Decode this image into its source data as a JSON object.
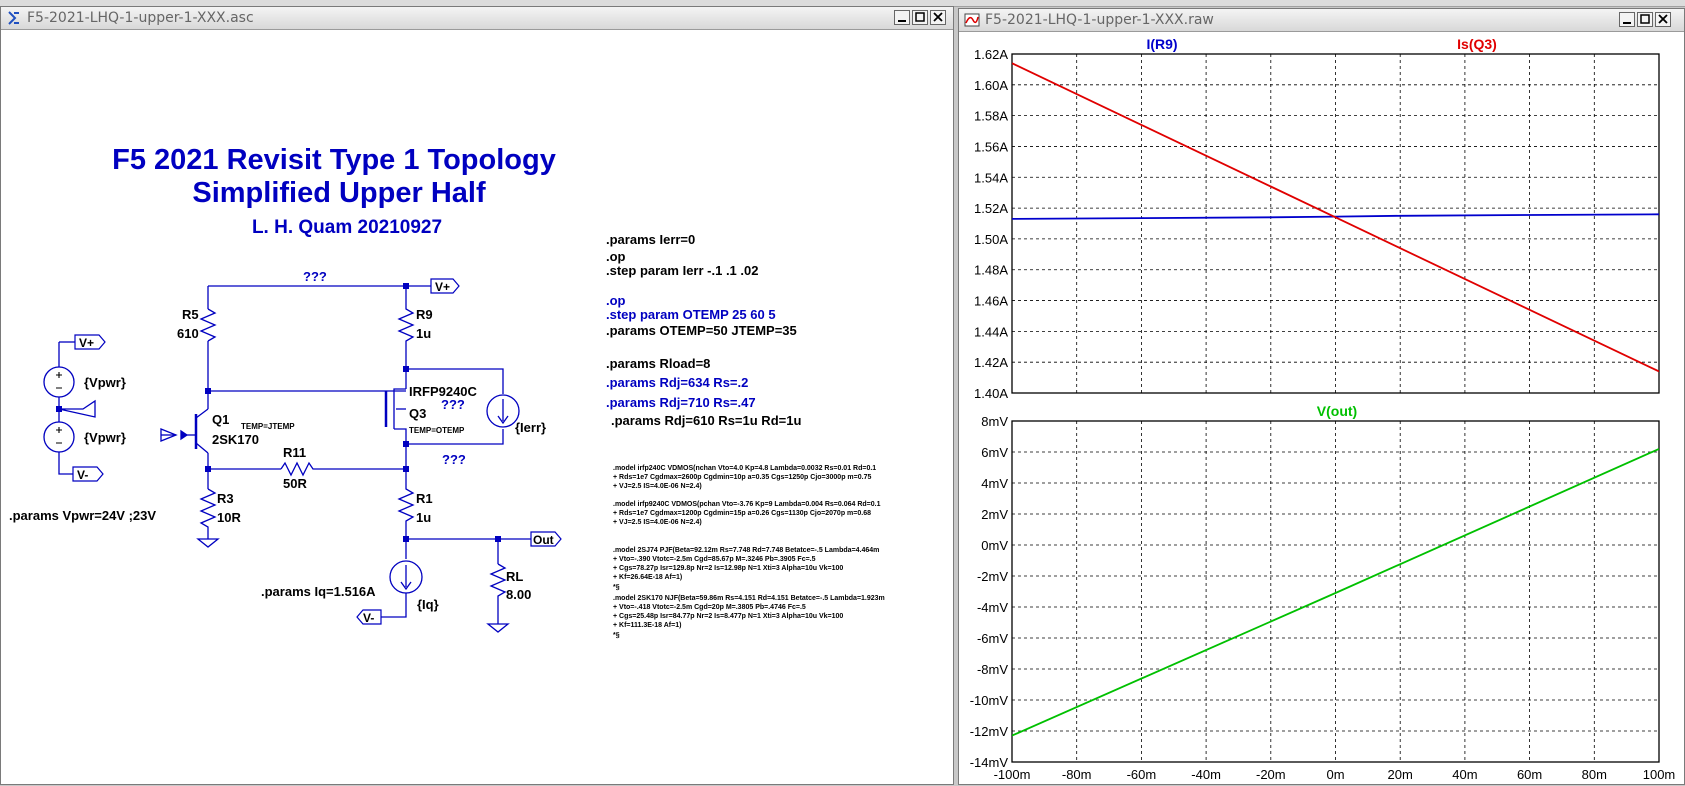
{
  "schematic_window": {
    "title": "F5-2021-LHQ-1-upper-1-XXX.asc",
    "heading": {
      "line1": "F5 2021 Revisit Type 1 Topology",
      "line2": "Simplified Upper Half",
      "author": "L. H. Quam  20210927"
    },
    "components": {
      "r5_name": "R5",
      "r5_value": "610",
      "r9_name": "R9",
      "r9_value": "1u",
      "r11_name": "R11",
      "r11_value": "50R",
      "r3_name": "R3",
      "r3_value": "10R",
      "r1_name": "R1",
      "r1_value": "1u",
      "rl_name": "RL",
      "rl_value": "8.00",
      "q1_name": "Q1",
      "q1_model": "2SK170",
      "q1_temp": "TEMP=JTEMP",
      "q3_name": "Q3",
      "q3_model": "IRFP9240C",
      "q3_temp": "TEMP=OTEMP",
      "vsrc_top": "{Vpwr}",
      "vsrc_bottom": "{Vpwr}",
      "isrc_ierr": "{Ierr}",
      "isrc_iq": "{Iq}",
      "unknown_1": "???",
      "unknown_2": "???",
      "unknown_3": "???",
      "vplus_label": "V+",
      "vplus_label_2": "V+",
      "vminus_label": "V-",
      "vminus_label_2": "V-",
      "out_label": "Out"
    },
    "params_vpwr": ".params Vpwr=24V ;23V",
    "params_iq": ".params Iq=1.516A",
    "directives": [
      {
        "text": ".params Ierr=0",
        "color": "#000000"
      },
      {
        "text": ".op",
        "color": "#000000"
      },
      {
        "text": ".step param Ierr -.1 .1 .02",
        "color": "#000000"
      },
      {
        "text": ".op",
        "color": "#0000c0"
      },
      {
        "text": ".step param OTEMP 25 60 5",
        "color": "#0000c0"
      },
      {
        "text": ".params OTEMP=50 JTEMP=35",
        "color": "#000000"
      },
      {
        "text": ".params Rload=8",
        "color": "#000000"
      },
      {
        "text": ".params Rdj=634 Rs=.2",
        "color": "#0000c0"
      },
      {
        "text": ".params Rdj=710 Rs=.47",
        "color": "#0000c0"
      },
      {
        "text": ".params Rdj=610 Rs=1u Rd=1u",
        "color": "#000000"
      }
    ],
    "models": [
      ".model irfp240C VDMOS(nchan Vto=4.0 Kp=4.8 Lambda=0.0032 Rs=0.01 Rd=0.1",
      "+ Rds=1e7 Cgdmax=2600p Cgdmin=10p a=0.35 Cgs=1250p Cjo=3000p m=0.75",
      "+ VJ=2.5 IS=4.0E-06 N=2.4)",
      ".model irfp9240C VDMOS(pchan Vto=-3.76 Kp=9 Lambda=0.004 Rs=0.064 Rd=0.1",
      "+ Rds=1e7 Cgdmax=1200p Cgdmin=15p a=0.26 Cgs=1130p Cjo=2070p m=0.68",
      "+ VJ=2.5 IS=4.0E-06 N=2.4)",
      ".model 2SJ74   PJF(Beta=92.12m Rs=7.748 Rd=7.748 Betatce=-.5 Lambda=4.464m",
      "+            Vto=-.390 Vtotc=-2.5m Cgd=85.67p M=.3246 Pb=.3905 Fc=.5",
      "+            Cgs=78.27p Isr=129.8p Nr=2 Is=12.98p N=1 Xti=3 Alpha=10u Vk=100",
      "+            Kf=26.64E-18 Af=1)",
      "*§",
      ".model 2SK170  NJF(Beta=59.86m Rs=4.151 Rd=4.151 Betatce=-.5 Lambda=1.923m",
      "+            Vto=-.418 Vtotc=-2.5m Cgd=20p M=.3805 Pb=.4746 Fc=.5",
      "+            Cgs=25.48p Isr=84.77p Nr=2 Is=8.477p N=1 Xti=3 Alpha=10u Vk=100",
      "+            Kf=111.3E-18 Af=1)",
      "*§"
    ]
  },
  "waveform_window": {
    "title": "F5-2021-LHQ-1-upper-1-XXX.raw",
    "chart_data": [
      {
        "type": "line",
        "series": [
          {
            "name": "I(R9)",
            "color": "#0000cc",
            "x": [
              -0.1,
              -0.06,
              -0.02,
              0,
              0.02,
              0.06,
              0.1
            ],
            "y": [
              1.513,
              1.5135,
              1.514,
              1.5145,
              1.515,
              1.5155,
              1.516
            ]
          },
          {
            "name": "Is(Q3)",
            "color": "#e00000",
            "x": [
              -0.1,
              -0.06,
              -0.02,
              0,
              0.02,
              0.06,
              0.1
            ],
            "y": [
              1.614,
              1.574,
              1.534,
              1.514,
              1.494,
              1.454,
              1.414
            ]
          }
        ],
        "xlim": [
          -0.1,
          0.1
        ],
        "ylim": [
          1.4,
          1.62
        ],
        "y_ticks": [
          "1.62A",
          "1.60A",
          "1.58A",
          "1.56A",
          "1.54A",
          "1.52A",
          "1.50A",
          "1.48A",
          "1.46A",
          "1.44A",
          "1.42A",
          "1.40A"
        ],
        "grid": true
      },
      {
        "type": "line",
        "series": [
          {
            "name": "V(out)",
            "color": "#00c000",
            "x": [
              -0.1,
              0,
              0.1
            ],
            "y": [
              -12.3,
              -3.1,
              6.2
            ]
          }
        ],
        "xlim": [
          -0.1,
          0.1
        ],
        "ylim": [
          -14,
          8
        ],
        "y_ticks": [
          "8mV",
          "6mV",
          "4mV",
          "2mV",
          "0mV",
          "-2mV",
          "-4mV",
          "-6mV",
          "-8mV",
          "-10mV",
          "-12mV",
          "-14mV"
        ],
        "x_ticks": [
          "-100m",
          "-80m",
          "-60m",
          "-40m",
          "-20m",
          "0m",
          "20m",
          "40m",
          "60m",
          "80m",
          "100m"
        ],
        "grid": true
      }
    ]
  }
}
